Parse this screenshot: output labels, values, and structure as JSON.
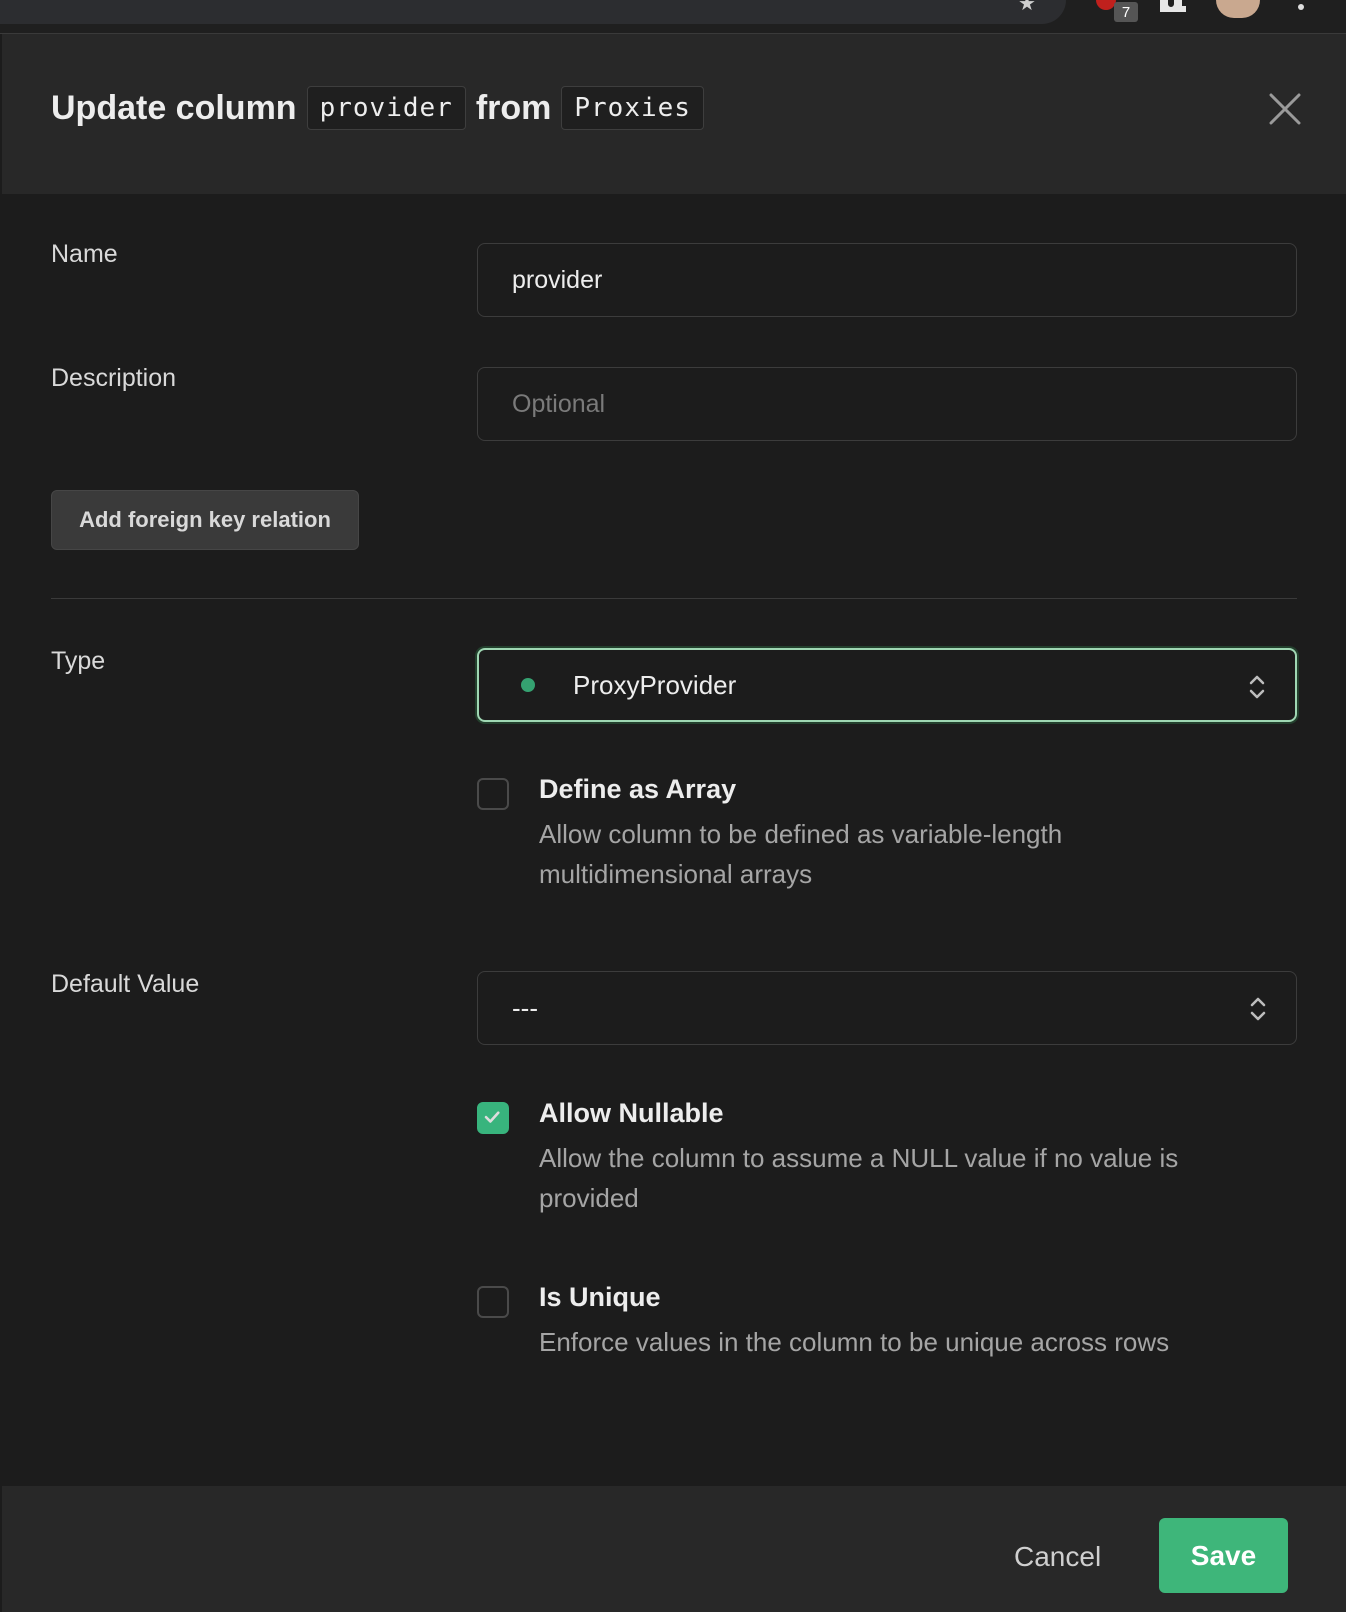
{
  "title": {
    "prefix": "Update column",
    "column_name": "provider",
    "middle": "from",
    "table_name": "Proxies"
  },
  "browser": {
    "extension_badge_count": "7"
  },
  "fields": {
    "name_label": "Name",
    "name_value": "provider",
    "description_label": "Description",
    "description_placeholder": "Optional",
    "foreign_key_button": "Add foreign key relation",
    "type_label": "Type",
    "type_value": "ProxyProvider",
    "default_label": "Default Value",
    "default_value": "---"
  },
  "options": [
    {
      "title": "Define as Array",
      "description": "Allow column to be defined as variable-length multidimensional arrays",
      "checked": false
    },
    {
      "title": "Allow Nullable",
      "description": "Allow the column to assume a NULL value if no value is provided",
      "checked": true
    },
    {
      "title": "Is Unique",
      "description": "Enforce values in the column to be unique across rows",
      "checked": false
    }
  ],
  "footer": {
    "cancel_label": "Cancel",
    "save_label": "Save"
  },
  "colors": {
    "accent": "#3ecf8e",
    "save_button": "#3eb67a",
    "background": "#1c1c1c",
    "header": "#282828"
  },
  "icons": [
    "star-icon",
    "extension-icon",
    "puzzle-icon",
    "avatar",
    "more-menu-icon",
    "close-icon",
    "chevron-up-down-icon",
    "checkmark-icon"
  ]
}
